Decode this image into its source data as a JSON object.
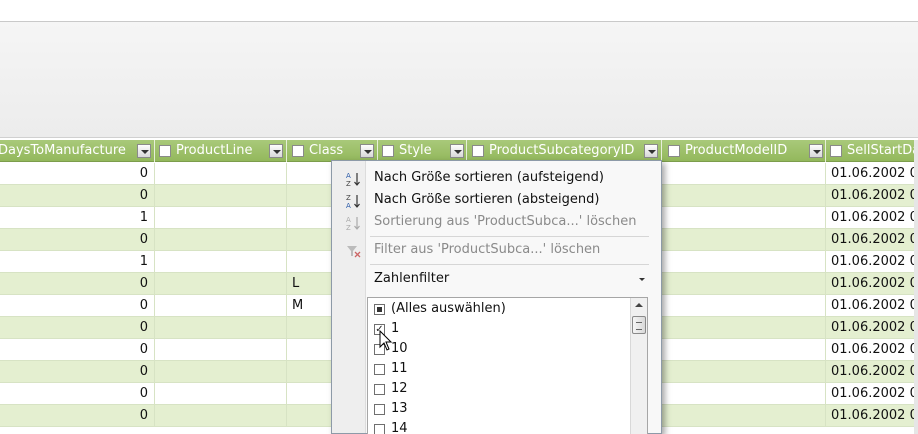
{
  "columns": [
    {
      "name": "DaysToManufacture"
    },
    {
      "name": "ProductLine"
    },
    {
      "name": "Class"
    },
    {
      "name": "Style"
    },
    {
      "name": "ProductSubcategoryID"
    },
    {
      "name": "ProductModelID"
    },
    {
      "name": "SellStartDa"
    }
  ],
  "rows": [
    {
      "days": "0",
      "cls": "",
      "sell": "01.06.2002 0"
    },
    {
      "days": "0",
      "cls": "",
      "sell": "01.06.2002 0"
    },
    {
      "days": "1",
      "cls": "",
      "sell": "01.06.2002 0"
    },
    {
      "days": "0",
      "cls": "",
      "sell": "01.06.2002 0"
    },
    {
      "days": "1",
      "cls": "",
      "sell": "01.06.2002 0"
    },
    {
      "days": "0",
      "cls": "L",
      "sell": "01.06.2002 0"
    },
    {
      "days": "0",
      "cls": "M",
      "sell": "01.06.2002 0"
    },
    {
      "days": "0",
      "cls": "",
      "sell": "01.06.2002 0"
    },
    {
      "days": "0",
      "cls": "",
      "sell": "01.06.2002 0"
    },
    {
      "days": "0",
      "cls": "",
      "sell": "01.06.2002 0"
    },
    {
      "days": "0",
      "cls": "",
      "sell": "01.06.2002 0"
    },
    {
      "days": "0",
      "cls": "",
      "sell": "01.06.2002 0"
    }
  ],
  "menu": {
    "sort_asc": "Nach Größe sortieren (aufsteigend)",
    "sort_desc": "Nach Größe sortieren (absteigend)",
    "clear_sort": "Sortierung aus 'ProductSubca...' löschen",
    "clear_filter": "Filter aus 'ProductSubca...' löschen",
    "number_filter": "Zahlenfilter"
  },
  "filter_list": [
    {
      "label": "(Alles auswählen)",
      "state": "partial"
    },
    {
      "label": "1",
      "state": "checked"
    },
    {
      "label": "10",
      "state": "unchecked"
    },
    {
      "label": "11",
      "state": "unchecked"
    },
    {
      "label": "12",
      "state": "unchecked"
    },
    {
      "label": "13",
      "state": "unchecked"
    },
    {
      "label": "14",
      "state": "unchecked"
    }
  ],
  "colors": {
    "header": "#9bbd66",
    "row_alt": "#e4efd0"
  }
}
